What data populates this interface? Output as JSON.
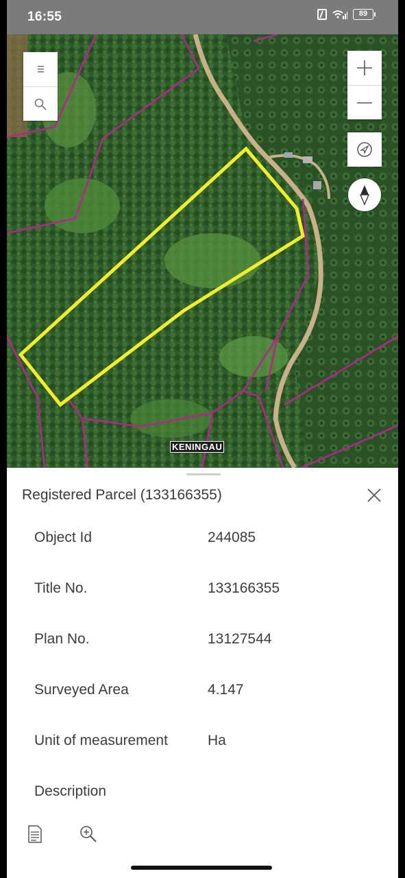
{
  "status_bar": {
    "time": "16:55",
    "battery": "89"
  },
  "map": {
    "place_label": "KENINGAU",
    "highlight_color": "#f2ee2a",
    "boundary_color": "#b5258f",
    "controls": {
      "menu_icon": "menu-icon",
      "search_icon": "search-icon",
      "zoom_in_icon": "plus-icon",
      "zoom_out_icon": "minus-icon",
      "locate_icon": "locate-icon",
      "compass_icon": "compass-icon"
    }
  },
  "panel": {
    "title": "Registered Parcel (133166355)",
    "attributes": [
      {
        "label": "Object Id",
        "value": "244085"
      },
      {
        "label": "Title No.",
        "value": "133166355"
      },
      {
        "label": "Plan No.",
        "value": "13127544"
      },
      {
        "label": "Surveyed Area",
        "value": "4.147"
      },
      {
        "label": "Unit of measurement",
        "value": "Ha"
      },
      {
        "label": "Description",
        "value": ""
      }
    ],
    "footer_icons": [
      "document-icon",
      "zoom-to-icon"
    ]
  }
}
